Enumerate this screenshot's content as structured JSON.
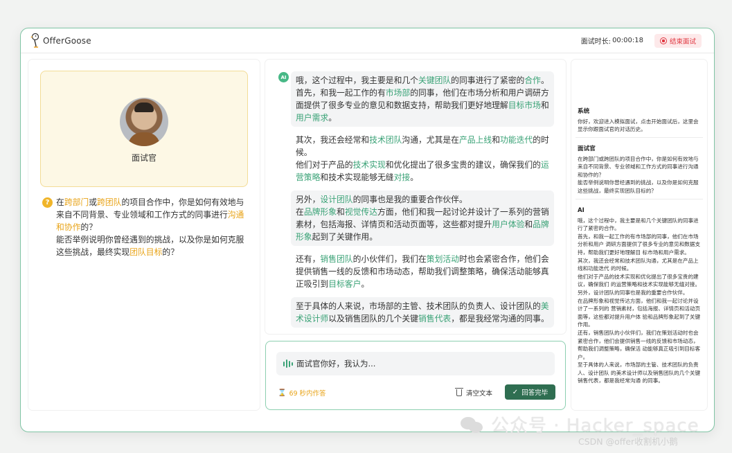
{
  "app": {
    "name": "OfferGoose"
  },
  "header": {
    "timer_label": "面试时长:",
    "timer_value": "00:00:18",
    "end_label": "结束面试"
  },
  "interviewer": {
    "name": "面试官"
  },
  "question": {
    "segments": [
      {
        "t": "在",
        "c": ""
      },
      {
        "t": "跨部门",
        "c": "o"
      },
      {
        "t": "或",
        "c": ""
      },
      {
        "t": "跨团队",
        "c": "o"
      },
      {
        "t": "的项目合作中，你是如何有效地与来自不同背景、专业领域和工作方式的同事进行",
        "c": ""
      },
      {
        "t": "沟通和协作",
        "c": "o"
      },
      {
        "t": "的？",
        "c": ""
      },
      {
        "t": "\n能否举例说明你曾经遇到的挑战，以及你是如何克服这些挑战，最终实现",
        "c": ""
      },
      {
        "t": "团队目标",
        "c": "o"
      },
      {
        "t": "的？",
        "c": ""
      }
    ]
  },
  "ai_badge": "AI",
  "chat": [
    {
      "shade": true,
      "segments": [
        {
          "t": "哦，这个过程中，我主要是和几个",
          "c": ""
        },
        {
          "t": "关键团队",
          "c": "g"
        },
        {
          "t": "的同事进行了紧密的",
          "c": ""
        },
        {
          "t": "合作",
          "c": "g"
        },
        {
          "t": "。\n首先，和我一起工作的有",
          "c": ""
        },
        {
          "t": "市场部",
          "c": "g"
        },
        {
          "t": "的同事，他们在市场分析和用户调研方面提供了很多专业的意见和数据支持，帮助我们更好地理解",
          "c": ""
        },
        {
          "t": "目标市场",
          "c": "g"
        },
        {
          "t": "和",
          "c": ""
        },
        {
          "t": "用户需求",
          "c": "g"
        },
        {
          "t": "。",
          "c": ""
        }
      ]
    },
    {
      "shade": false,
      "segments": [
        {
          "t": "其次，我还会经常和",
          "c": ""
        },
        {
          "t": "技术团队",
          "c": "g"
        },
        {
          "t": "沟通，尤其是在",
          "c": ""
        },
        {
          "t": "产品上线",
          "c": "g"
        },
        {
          "t": "和",
          "c": ""
        },
        {
          "t": "功能迭代",
          "c": "g"
        },
        {
          "t": "的时候。\n他们对于产品的",
          "c": ""
        },
        {
          "t": "技术实现",
          "c": "g"
        },
        {
          "t": "和优化提出了很多宝贵的建议，确保我们的",
          "c": ""
        },
        {
          "t": "运营策略",
          "c": "g"
        },
        {
          "t": "和技术实现能够无缝",
          "c": ""
        },
        {
          "t": "对接",
          "c": "g"
        },
        {
          "t": "。",
          "c": ""
        }
      ]
    },
    {
      "shade": true,
      "segments": [
        {
          "t": "另外，",
          "c": ""
        },
        {
          "t": "设计团队",
          "c": "g"
        },
        {
          "t": "的同事也是我的重要合作伙伴。\n在",
          "c": ""
        },
        {
          "t": "品牌形象",
          "c": "g"
        },
        {
          "t": "和",
          "c": ""
        },
        {
          "t": "视觉传达",
          "c": "g"
        },
        {
          "t": "方面，他们和我一起讨论并设计了一系列的营销素材，包括海报、详情页和活动页面等，这些都对提升",
          "c": ""
        },
        {
          "t": "用户体验",
          "c": "g"
        },
        {
          "t": "和",
          "c": ""
        },
        {
          "t": "品牌形象",
          "c": "g"
        },
        {
          "t": "起到了关键作用。",
          "c": ""
        }
      ]
    },
    {
      "shade": false,
      "segments": [
        {
          "t": "还有，",
          "c": ""
        },
        {
          "t": "销售团队",
          "c": "g"
        },
        {
          "t": "的小伙伴们，我们在",
          "c": ""
        },
        {
          "t": "策划活动",
          "c": "g"
        },
        {
          "t": "时也会紧密合作，他们会提供销售一线的反馈和市场动态，帮助我们调整策略，确保活动能够真正吸引到",
          "c": ""
        },
        {
          "t": "目标客户",
          "c": "g"
        },
        {
          "t": "。",
          "c": ""
        }
      ]
    },
    {
      "shade": true,
      "segments": [
        {
          "t": "至于具体的人来说，市场部的主管、技术团队的负责人、设计团队的",
          "c": ""
        },
        {
          "t": "美术设计师",
          "c": "g"
        },
        {
          "t": "以及销售团队的几个关键",
          "c": ""
        },
        {
          "t": "销售代表",
          "c": "g"
        },
        {
          "t": "，都是我经常沟通的同事。",
          "c": ""
        }
      ]
    }
  ],
  "input": {
    "text": "面试官你好，我认为...",
    "countdown": "69 秒内作答",
    "clear_label": "清空文本",
    "done_label": "回答完毕"
  },
  "history": [
    {
      "title": "系统",
      "text": "你好，欢迎进入模拟面试，点击开始面试后，这里会显示你跟面试官的对话历史。"
    },
    {
      "title": "面试官",
      "text": "在跨部门或跨团队的项目合作中，你是如何有效地与来自不同背景、专业领域和工作方式的同事进行沟通和协作的？\n能否举例说明你曾经遇到的挑战，以及你是如何克服这些挑战，最终实现团队目标的？"
    },
    {
      "title": "AI",
      "text": "哦，这个过程中，我主要是和几个关键团队的同事进行了紧密的合作。\n首先，和我一起工作的有市场部的同事，他们在市场分析和用户 调研方面提供了很多专业的意见和数据支持，帮助我们更好地理解目 标市场和用户需求。\n其次，我还会经常和技术团队沟通，尤其是在产品上线和功能迭代 的时候。\n他们对于产品的技术实现和优化提出了很多宝贵的建议，确保我们 的运营策略和技术实现能够无缝对接。\n另外，设计团队的同事也是我的重要合作伙伴。\n在品牌形象和视觉传达方面，他们和我一起讨论并设计了一系列的 营销素材，包括海报、详情页和活动页面等，这些都对提升用户体 验和品牌形象起到了关键作用。\n还有，销售团队的小伙伴们，我们在策划活动时也会紧密合作，他们会提供销售一线的反馈和市场动态，帮助我们调整策略，确保活 动能够真正吸引到目标客户。\n至于具体的人来说，市场部的主管、技术团队的负责人、设计团队 的美术设计师以及销售团队的几个关键销售代表，都是我经常沟通 的同事。"
    }
  ],
  "watermark": {
    "text": "公众号 · Hacker_space",
    "credit": "CSDN @offer收割机小鹅"
  }
}
